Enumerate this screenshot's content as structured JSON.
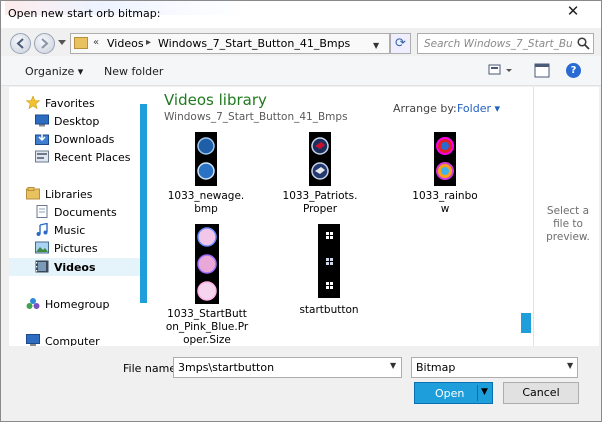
{
  "title": "Open new start orb bitmap:",
  "colors": {
    "accent": "#1e9fdc",
    "library_title": "#1f7a1f",
    "link": "#1f5fbf"
  },
  "nav": {
    "breadcrumb_prefix": "«",
    "crumbs": [
      "Videos",
      "Windows_7_Start_Button_41_Bmps"
    ],
    "crumb_sep": "▸",
    "search_placeholder": "Search Windows_7_Start_Butto..."
  },
  "toolbar": {
    "organize_label": "Organize ▾",
    "new_folder_label": "New folder",
    "views_icon": "view-icon",
    "preview_icon": "preview-pane-icon",
    "help_icon": "help-icon"
  },
  "sidebar": {
    "items": [
      {
        "label": "Favorites",
        "icon": "star-icon"
      },
      {
        "label": "Desktop",
        "icon": "desktop-icon"
      },
      {
        "label": "Downloads",
        "icon": "downloads-icon"
      },
      {
        "label": "Recent Places",
        "icon": "recent-places-icon"
      },
      {
        "label": "Libraries",
        "icon": "libraries-icon"
      },
      {
        "label": "Documents",
        "icon": "documents-icon"
      },
      {
        "label": "Music",
        "icon": "music-icon"
      },
      {
        "label": "Pictures",
        "icon": "pictures-icon"
      },
      {
        "label": "Videos",
        "icon": "videos-icon"
      },
      {
        "label": "Homegroup",
        "icon": "homegroup-icon"
      },
      {
        "label": "Computer",
        "icon": "computer-icon"
      }
    ]
  },
  "library": {
    "title": "Videos library",
    "path": "Windows_7_Start_Button_41_Bmps",
    "arrange_label": "Arrange by:",
    "arrange_value": "Folder ▾"
  },
  "files": [
    {
      "name": "1033_newage.bmp"
    },
    {
      "name": "1033_Patriots.Proper"
    },
    {
      "name": "1033_rainbow"
    },
    {
      "name": "1033_StartButton_Pink_Blue.Proper.Size"
    },
    {
      "name": "startbutton"
    }
  ],
  "preview_text": "Select a file to preview.",
  "footer": {
    "filename_label": "File name:",
    "filename_value": "3mps\\startbutton",
    "filetype_value": "Bitmap",
    "open_label": "Open",
    "cancel_label": "Cancel"
  }
}
